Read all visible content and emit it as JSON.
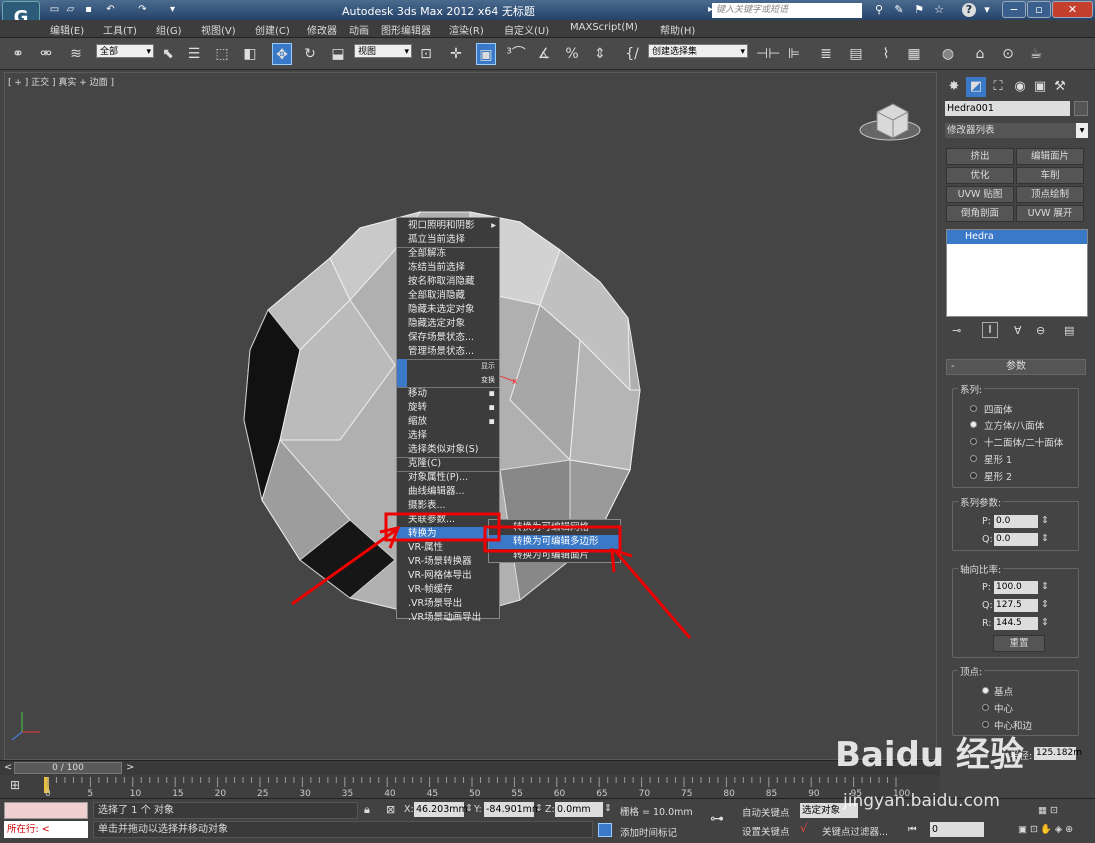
{
  "titlebar": {
    "app_icon": "3ds-max-logo",
    "title": "Autodesk 3ds Max  2012 x64       无标题",
    "search_placeholder": "键入关键字或短语"
  },
  "menubar": [
    "编辑(E)",
    "工具(T)",
    "组(G)",
    "视图(V)",
    "创建(C)",
    "修改器",
    "动画",
    "图形编辑器",
    "渲染(R)",
    "自定义(U)",
    "MAXScript(M)",
    "帮助(H)"
  ],
  "toolbar": {
    "selection_filter": "全部",
    "reference_coord": "视图",
    "named_selection": "创建选择集"
  },
  "viewport": {
    "label": "[ + ] 正交 ] 真实 + 边面 ]"
  },
  "quad_menu": {
    "items": [
      "视口照明和阴影",
      "孤立当前选择",
      "全部解冻",
      "冻结当前选择",
      "按名称取消隐藏",
      "全部取消隐藏",
      "隐藏未选定对象",
      "隐藏选定对象",
      "保存场景状态...",
      "管理场景状态...",
      "显示",
      "变换",
      "移动",
      "旋转",
      "缩放",
      "选择",
      "选择类似对象(S)",
      "克隆(C)",
      "对象属性(P)...",
      "曲线编辑器...",
      "摄影表...",
      "关联参数...",
      "转换为",
      "VR-属性",
      "VR-场景转换器",
      "VR-网格体导出",
      "VR-帧缓存",
      ".VR场景导出",
      ".VR场景动画导出"
    ],
    "submenu": [
      "转换为可编辑网格",
      "转换为可编辑多边形",
      "转换为可编辑面片"
    ]
  },
  "panel": {
    "object_name": "Hedra001",
    "modifier_list": "修改器列表",
    "buttons": [
      "挤出",
      "编辑面片",
      "优化",
      "车削",
      "UVW 贴图",
      "顶点绘制",
      "倒角剖面",
      "UVW 展开"
    ],
    "stack_item": "Hedra",
    "rollout_title": "参数",
    "family_label": "系列:",
    "families": [
      "四面体",
      "立方体/八面体",
      "十二面体/二十面体",
      "星形 1",
      "星形 2"
    ],
    "family_params_label": "系列参数:",
    "p_label": "P:",
    "p_value": "0.0",
    "q_label": "Q:",
    "q_value": "0.0",
    "axis_label": "轴向比率:",
    "ap_value": "100.0",
    "aq_value": "127.5",
    "ar_value": "144.5",
    "r_label": "R:",
    "reset": "重置",
    "vertex_label": "顶点:",
    "vertices": [
      "基点",
      "中心",
      "中心和边"
    ],
    "radius_label": "半径:",
    "radius_value": "125.182m"
  },
  "timeline": {
    "frame": "0 / 100",
    "ticks": [
      "0",
      "5",
      "10",
      "15",
      "20",
      "25",
      "30",
      "35",
      "40",
      "45",
      "50",
      "55",
      "60",
      "65",
      "70",
      "75",
      "80",
      "85",
      "90",
      "95",
      "100"
    ]
  },
  "status": {
    "selected": "选择了 1 个 对象",
    "hint": "单击并拖动以选择并移动对象",
    "running": "所在行:",
    "x_label": "X:",
    "x": "46.203mm",
    "y_label": "Y:",
    "y": "-84.901mm",
    "z_label": "Z:",
    "z": "0.0mm",
    "grid": "栅格 = 10.0mm",
    "add_time_tag": "添加时间标记",
    "auto_key": "自动关键点",
    "set_key": "设置关键点",
    "key_mode": "选定对象",
    "key_filters": "关键点过滤器...",
    "frame_field": "0"
  },
  "watermark": {
    "brand": "Baidu 经验",
    "url": "jingyan.baidu.com"
  }
}
